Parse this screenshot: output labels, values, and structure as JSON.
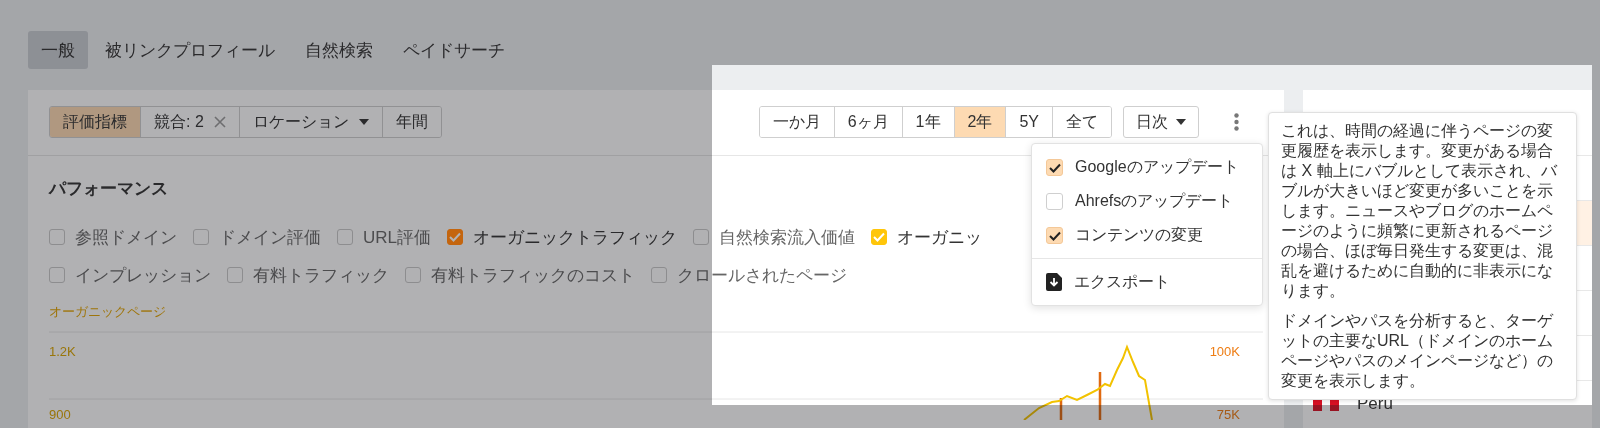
{
  "tabs": [
    {
      "label": "一般",
      "selected": true
    },
    {
      "label": "被リンクプロフィール",
      "selected": false
    },
    {
      "label": "自然検索",
      "selected": false
    },
    {
      "label": "ペイドサーチ",
      "selected": false
    }
  ],
  "filters": [
    {
      "kind": "toggle",
      "label": "評価指標",
      "selected": true
    },
    {
      "kind": "removable",
      "label": "競合: 2",
      "selected": false
    },
    {
      "kind": "dropdown",
      "label": "ロケーション",
      "selected": false
    },
    {
      "kind": "toggle",
      "label": "年間",
      "selected": false
    }
  ],
  "ranges": [
    {
      "label": "一か月",
      "selected": false
    },
    {
      "label": "6ヶ月",
      "selected": false
    },
    {
      "label": "1年",
      "selected": false
    },
    {
      "label": "2年",
      "selected": true
    },
    {
      "label": "5Y",
      "selected": false
    },
    {
      "label": "全て",
      "selected": false
    }
  ],
  "interval": {
    "label": "日次"
  },
  "section_title": "パフォーマンス",
  "metric_rows": [
    [
      {
        "label": "参照ドメイン",
        "checked": false
      },
      {
        "label": "ドメイン評価",
        "checked": false
      },
      {
        "label": "URL評価",
        "checked": false
      },
      {
        "label": "オーガニックトラフィック",
        "checked": true,
        "color": "#c4650e"
      },
      {
        "label": "自然検索流入価値",
        "checked": false
      },
      {
        "label": "オーガニッ",
        "checked": true,
        "color": "#ffc60a"
      }
    ],
    [
      {
        "label": "インプレッション",
        "checked": false
      },
      {
        "label": "有料トラフィック",
        "checked": false
      },
      {
        "label": "有料トラフィックのコスト",
        "checked": false
      },
      {
        "label": "クロールされたページ",
        "checked": false
      }
    ]
  ],
  "chart": {
    "series_label": "オーガニックページ",
    "left_ticks": [
      "1.2K",
      "900"
    ],
    "right_ticks": [
      "100K",
      "75K"
    ]
  },
  "menu": {
    "items": [
      {
        "kind": "checkbox",
        "label": "Googleのアップデート",
        "checked": true
      },
      {
        "kind": "checkbox",
        "label": "Ahrefsのアップデート",
        "checked": false
      },
      {
        "kind": "checkbox",
        "label": "コンテンツの変更",
        "checked": true
      },
      {
        "kind": "action",
        "label": "エクスポート"
      }
    ]
  },
  "tooltip": {
    "paragraphs": [
      "これは、時間の経過に伴うページの変更履歴を表示します。変更がある場合は X 軸上にバブルとして表示され、バブルが大きいほど変更が多いことを示します。ニュースやブログのホームページのように頻繁に更新されるページの場合、ほぼ毎日発生する変更は、混乱を避けるために自動的に非表示になります。",
      "ドメインやパスを分析すると、ターゲットの主要なURL（ドメインのホームページやパスのメインページなど）の変更を表示します。"
    ]
  },
  "side": {
    "country": "Peru"
  }
}
